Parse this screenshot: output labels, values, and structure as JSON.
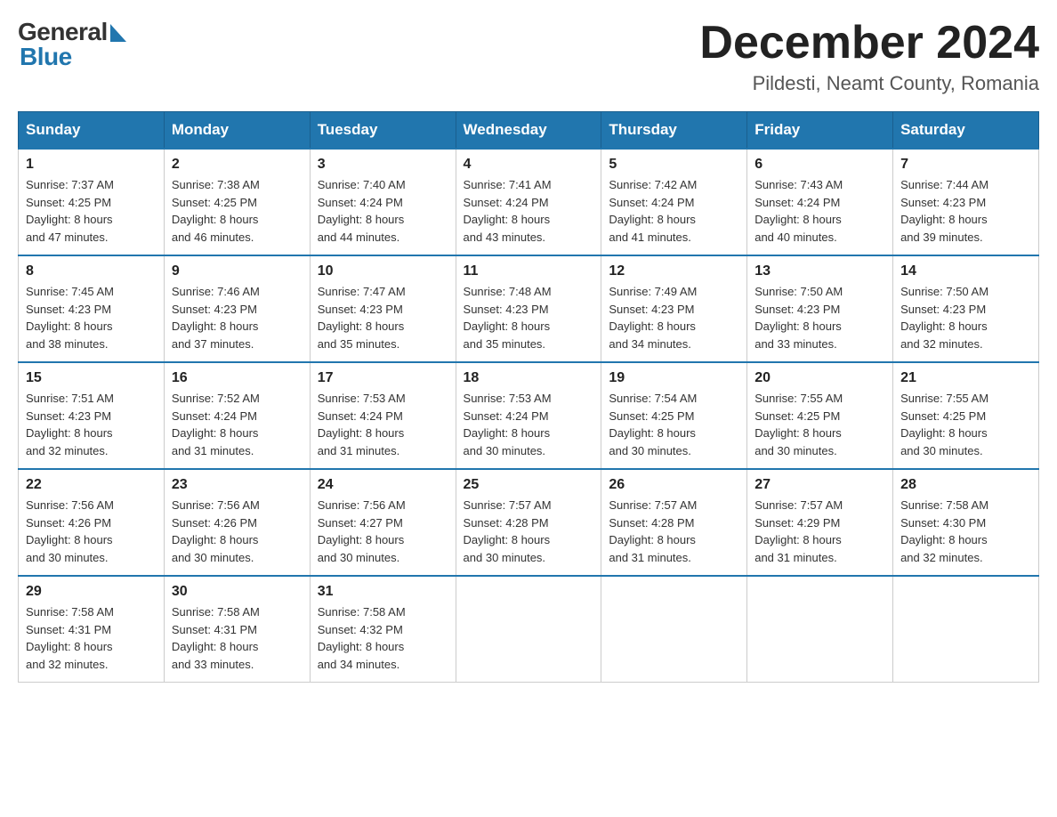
{
  "header": {
    "logo": {
      "general": "General",
      "blue": "Blue"
    },
    "title": "December 2024",
    "location": "Pildesti, Neamt County, Romania"
  },
  "days_of_week": [
    "Sunday",
    "Monday",
    "Tuesday",
    "Wednesday",
    "Thursday",
    "Friday",
    "Saturday"
  ],
  "weeks": [
    [
      {
        "day": "1",
        "sunrise": "7:37 AM",
        "sunset": "4:25 PM",
        "daylight": "8 hours and 47 minutes."
      },
      {
        "day": "2",
        "sunrise": "7:38 AM",
        "sunset": "4:25 PM",
        "daylight": "8 hours and 46 minutes."
      },
      {
        "day": "3",
        "sunrise": "7:40 AM",
        "sunset": "4:24 PM",
        "daylight": "8 hours and 44 minutes."
      },
      {
        "day": "4",
        "sunrise": "7:41 AM",
        "sunset": "4:24 PM",
        "daylight": "8 hours and 43 minutes."
      },
      {
        "day": "5",
        "sunrise": "7:42 AM",
        "sunset": "4:24 PM",
        "daylight": "8 hours and 41 minutes."
      },
      {
        "day": "6",
        "sunrise": "7:43 AM",
        "sunset": "4:24 PM",
        "daylight": "8 hours and 40 minutes."
      },
      {
        "day": "7",
        "sunrise": "7:44 AM",
        "sunset": "4:23 PM",
        "daylight": "8 hours and 39 minutes."
      }
    ],
    [
      {
        "day": "8",
        "sunrise": "7:45 AM",
        "sunset": "4:23 PM",
        "daylight": "8 hours and 38 minutes."
      },
      {
        "day": "9",
        "sunrise": "7:46 AM",
        "sunset": "4:23 PM",
        "daylight": "8 hours and 37 minutes."
      },
      {
        "day": "10",
        "sunrise": "7:47 AM",
        "sunset": "4:23 PM",
        "daylight": "8 hours and 35 minutes."
      },
      {
        "day": "11",
        "sunrise": "7:48 AM",
        "sunset": "4:23 PM",
        "daylight": "8 hours and 35 minutes."
      },
      {
        "day": "12",
        "sunrise": "7:49 AM",
        "sunset": "4:23 PM",
        "daylight": "8 hours and 34 minutes."
      },
      {
        "day": "13",
        "sunrise": "7:50 AM",
        "sunset": "4:23 PM",
        "daylight": "8 hours and 33 minutes."
      },
      {
        "day": "14",
        "sunrise": "7:50 AM",
        "sunset": "4:23 PM",
        "daylight": "8 hours and 32 minutes."
      }
    ],
    [
      {
        "day": "15",
        "sunrise": "7:51 AM",
        "sunset": "4:23 PM",
        "daylight": "8 hours and 32 minutes."
      },
      {
        "day": "16",
        "sunrise": "7:52 AM",
        "sunset": "4:24 PM",
        "daylight": "8 hours and 31 minutes."
      },
      {
        "day": "17",
        "sunrise": "7:53 AM",
        "sunset": "4:24 PM",
        "daylight": "8 hours and 31 minutes."
      },
      {
        "day": "18",
        "sunrise": "7:53 AM",
        "sunset": "4:24 PM",
        "daylight": "8 hours and 30 minutes."
      },
      {
        "day": "19",
        "sunrise": "7:54 AM",
        "sunset": "4:25 PM",
        "daylight": "8 hours and 30 minutes."
      },
      {
        "day": "20",
        "sunrise": "7:55 AM",
        "sunset": "4:25 PM",
        "daylight": "8 hours and 30 minutes."
      },
      {
        "day": "21",
        "sunrise": "7:55 AM",
        "sunset": "4:25 PM",
        "daylight": "8 hours and 30 minutes."
      }
    ],
    [
      {
        "day": "22",
        "sunrise": "7:56 AM",
        "sunset": "4:26 PM",
        "daylight": "8 hours and 30 minutes."
      },
      {
        "day": "23",
        "sunrise": "7:56 AM",
        "sunset": "4:26 PM",
        "daylight": "8 hours and 30 minutes."
      },
      {
        "day": "24",
        "sunrise": "7:56 AM",
        "sunset": "4:27 PM",
        "daylight": "8 hours and 30 minutes."
      },
      {
        "day": "25",
        "sunrise": "7:57 AM",
        "sunset": "4:28 PM",
        "daylight": "8 hours and 30 minutes."
      },
      {
        "day": "26",
        "sunrise": "7:57 AM",
        "sunset": "4:28 PM",
        "daylight": "8 hours and 31 minutes."
      },
      {
        "day": "27",
        "sunrise": "7:57 AM",
        "sunset": "4:29 PM",
        "daylight": "8 hours and 31 minutes."
      },
      {
        "day": "28",
        "sunrise": "7:58 AM",
        "sunset": "4:30 PM",
        "daylight": "8 hours and 32 minutes."
      }
    ],
    [
      {
        "day": "29",
        "sunrise": "7:58 AM",
        "sunset": "4:31 PM",
        "daylight": "8 hours and 32 minutes."
      },
      {
        "day": "30",
        "sunrise": "7:58 AM",
        "sunset": "4:31 PM",
        "daylight": "8 hours and 33 minutes."
      },
      {
        "day": "31",
        "sunrise": "7:58 AM",
        "sunset": "4:32 PM",
        "daylight": "8 hours and 34 minutes."
      },
      null,
      null,
      null,
      null
    ]
  ],
  "labels": {
    "sunrise": "Sunrise:",
    "sunset": "Sunset:",
    "daylight": "Daylight:"
  }
}
